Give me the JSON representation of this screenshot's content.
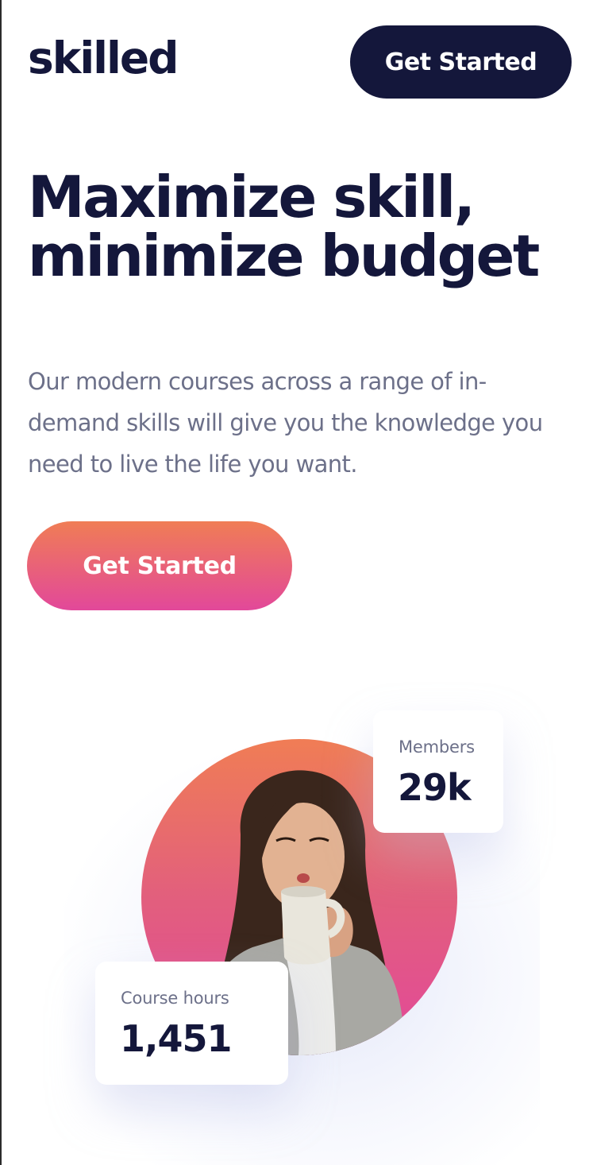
{
  "header": {
    "logo": "skilled",
    "cta_label": "Get Started"
  },
  "hero": {
    "title_line1": "Maximize skill,",
    "title_line2": "minimize budget",
    "description": "Our modern courses across a range of in-demand skills will give you the knowledge you need to live the life you want.",
    "cta_label": "Get Started"
  },
  "stats": {
    "members": {
      "label": "Members",
      "value": "29k"
    },
    "course_hours": {
      "label": "Course hours",
      "value": "1,451"
    }
  },
  "colors": {
    "navy": "#14173b",
    "gradient_start": "#f07d55",
    "gradient_end": "#e2489a",
    "body_text": "#6c7089"
  }
}
